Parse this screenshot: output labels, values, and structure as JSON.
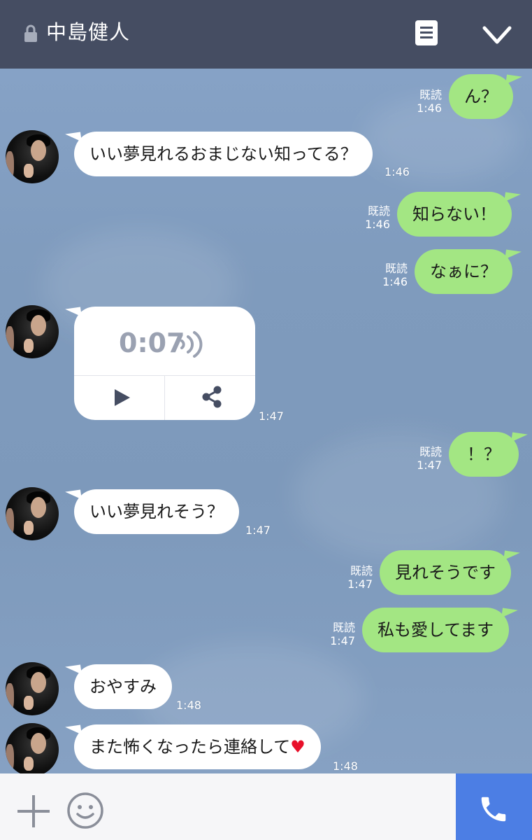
{
  "header": {
    "title": "中島健人",
    "lock_icon": "lock-icon",
    "notes_icon": "notes-icon",
    "collapse_icon": "chevron-down-icon"
  },
  "colors": {
    "header_bg": "#454d62",
    "chat_bg": "#7f9bbd",
    "outgoing_bubble": "#a3e683",
    "incoming_bubble": "#ffffff",
    "call_button": "#4c7ee4"
  },
  "messages": [
    {
      "dir": "out",
      "text": "ん？",
      "read": "既読",
      "time": "1:46"
    },
    {
      "dir": "in",
      "text": "いい夢見れるおまじない知ってる？",
      "time": "1:46"
    },
    {
      "dir": "out",
      "text": "知らない！",
      "read": "既読",
      "time": "1:46"
    },
    {
      "dir": "out",
      "text": "なぁに？",
      "read": "既読",
      "time": "1:46"
    },
    {
      "dir": "in",
      "type": "voice",
      "duration": "0:07",
      "time": "1:47"
    },
    {
      "dir": "out",
      "text": "！？",
      "read": "既読",
      "time": "1:47"
    },
    {
      "dir": "in",
      "text": "いい夢見れそう？",
      "time": "1:47"
    },
    {
      "dir": "out",
      "text": "見れそうです",
      "read": "既読",
      "time": "1:47"
    },
    {
      "dir": "out",
      "text": "私も愛してます",
      "read": "既読",
      "time": "1:47"
    },
    {
      "dir": "in",
      "text": "おやすみ",
      "time": "1:48"
    },
    {
      "dir": "in",
      "text": "また怖くなったら連絡して",
      "suffix": "♥",
      "time": "1:48"
    }
  ],
  "inputbar": {
    "plus_icon": "plus-icon",
    "emoji_icon": "smile-icon",
    "call_icon": "phone-icon"
  }
}
